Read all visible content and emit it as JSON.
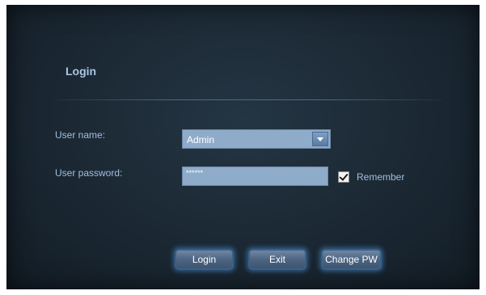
{
  "dialog": {
    "title": "Login",
    "user_name_label": "User name:",
    "user_password_label": "User password:",
    "user_name_value": "Admin",
    "password_mask": "******",
    "remember_label": "Remember",
    "remember_checked": true
  },
  "buttons": {
    "login": "Login",
    "exit": "Exit",
    "change_pw": "Change PW"
  },
  "colors": {
    "background": "#1b2833",
    "label": "#a3bfe0",
    "field": "#8eabc9",
    "button_glow": "#468cd2"
  },
  "icons": {
    "dropdown": "chevron-down-icon",
    "remember": "checkmark-icon"
  }
}
